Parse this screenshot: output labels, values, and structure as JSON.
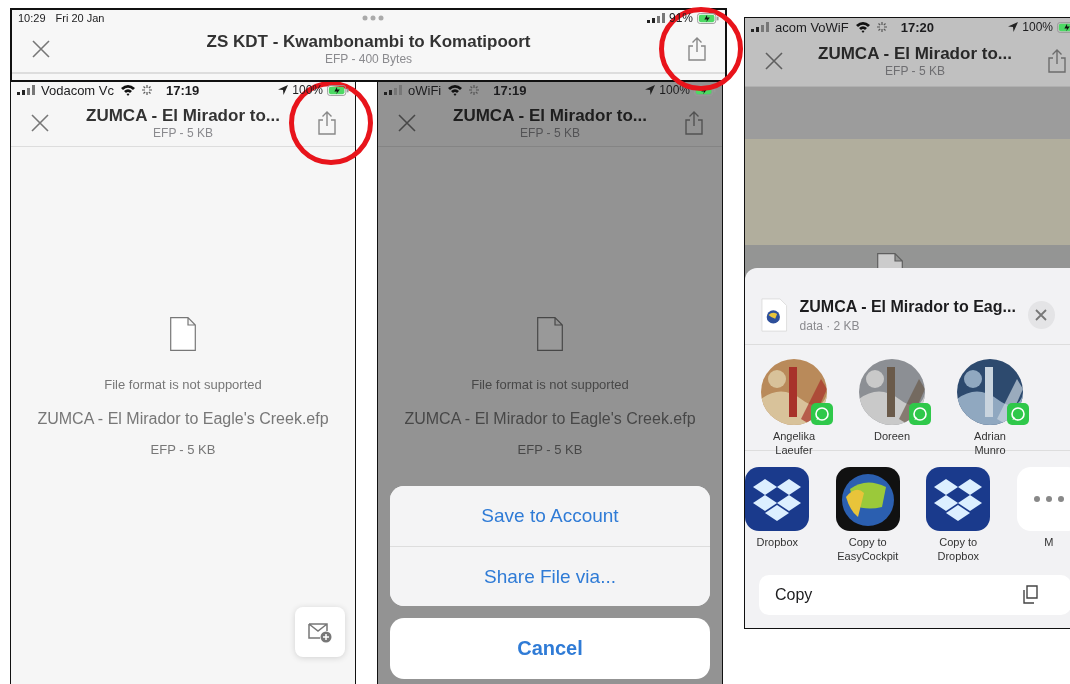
{
  "banner": {
    "status_bar": {
      "time": "10:29",
      "date": "Fri 20 Jan",
      "battery": "91%"
    },
    "title": "ZS KDT - Kwambonambi to Komatipoort",
    "subtitle": "EFP - 400 Bytes",
    "share_circled": true
  },
  "phones": [
    {
      "status_bar": {
        "carrier": "Vodacom Vc",
        "time": "17:19",
        "battery": "100%"
      },
      "title": "ZUMCA - El Mirador to...",
      "subtitle": "EFP - 5 KB",
      "share_circled": true,
      "dimmed": false,
      "message": "File format is not supported",
      "file_name": "ZUMCA - El Mirador to Eagle's Creek.efp",
      "file_info": "EFP - 5 KB",
      "compose_button": true
    },
    {
      "status_bar": {
        "carrier": "oWiFi",
        "time": "17:19",
        "battery": "100%"
      },
      "title": "ZUMCA - El Mirador to...",
      "subtitle": "EFP - 5 KB",
      "dimmed": true,
      "message": "File format is not supported",
      "file_name": "ZUMCA - El Mirador to Eagle's Creek.efp",
      "file_info": "EFP - 5 KB",
      "action_sheet": {
        "actions": [
          "Save to Account",
          "Share File via..."
        ],
        "cancel": "Cancel"
      }
    }
  ],
  "share_phone": {
    "status_bar": {
      "carrier": "acom VoWiF",
      "time": "17:20",
      "battery": "100%"
    },
    "title": "ZUMCA - El Mirador to...",
    "subtitle": "EFP - 5 KB",
    "share_sheet": {
      "file_title": "ZUMCA - El Mirador to Eag...",
      "file_info": "data · 2 KB",
      "contacts": [
        {
          "name": "Angelika Laeufer"
        },
        {
          "name": "Doreen"
        },
        {
          "name": "Adrian Munro"
        }
      ],
      "apps": [
        {
          "kind": "dropbox",
          "label": "Dropbox"
        },
        {
          "kind": "globe",
          "label": "Copy to EasyCockpit"
        },
        {
          "kind": "dropbox",
          "label": "Copy to Dropbox"
        },
        {
          "kind": "more",
          "label": "M"
        }
      ],
      "actions": [
        "Copy"
      ]
    }
  }
}
